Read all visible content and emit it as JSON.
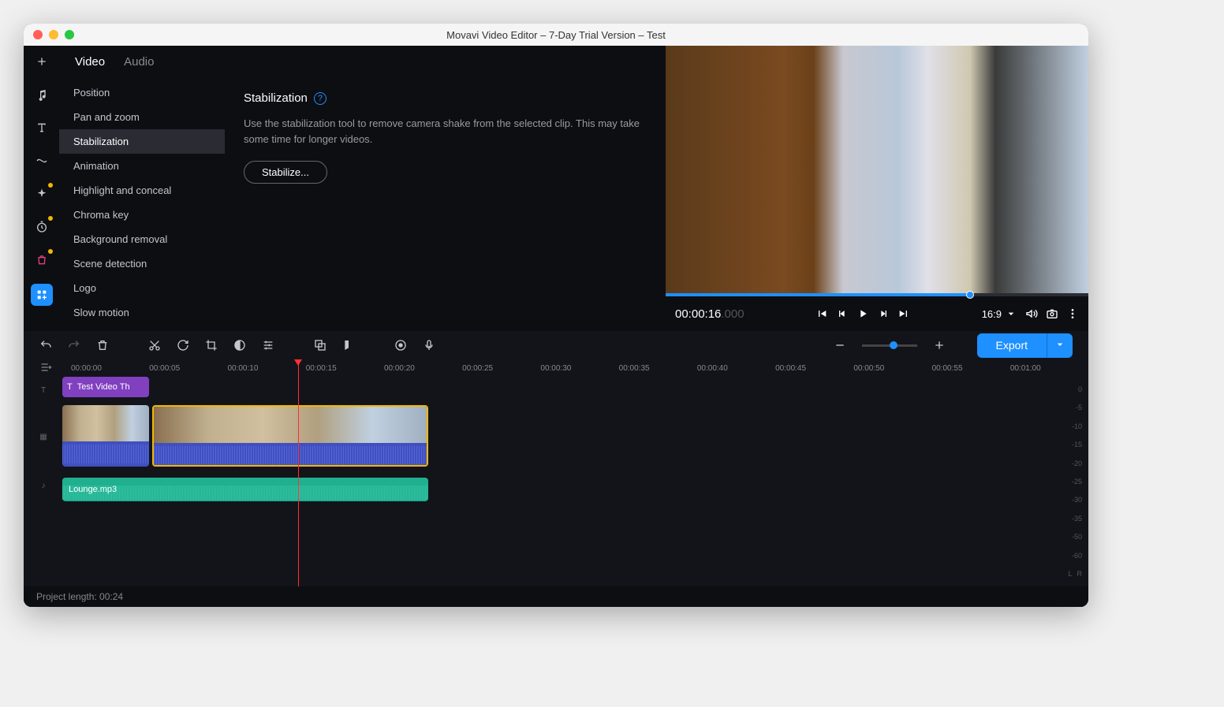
{
  "window": {
    "title": "Movavi Video Editor – 7-Day Trial Version – Test"
  },
  "tabs": {
    "video": "Video",
    "audio": "Audio"
  },
  "sidebar": {
    "items": [
      "Position",
      "Pan and zoom",
      "Stabilization",
      "Animation",
      "Highlight and conceal",
      "Chroma key",
      "Background removal",
      "Scene detection",
      "Logo",
      "Slow motion"
    ]
  },
  "content": {
    "title": "Stabilization",
    "desc": "Use the stabilization tool to remove camera shake from the selected clip. This may take some time for longer videos.",
    "button": "Stabilize..."
  },
  "preview": {
    "timecode": "00:00:16",
    "timecode_ms": ".000",
    "aspect": "16:9"
  },
  "export": {
    "label": "Export"
  },
  "ruler": [
    "00:00:00",
    "00:00:05",
    "00:00:10",
    "00:00:15",
    "00:00:20",
    "00:00:25",
    "00:00:30",
    "00:00:35",
    "00:00:40",
    "00:00:45",
    "00:00:50",
    "00:00:55",
    "00:01:00"
  ],
  "clips": {
    "title": "Test Video Th",
    "audio": "Lounge.mp3"
  },
  "meter": [
    "0",
    "-5",
    "-10",
    "-15",
    "-20",
    "-25",
    "-30",
    "-35",
    "-50",
    "-60"
  ],
  "meter_lr": {
    "l": "L",
    "r": "R"
  },
  "status": {
    "length": "Project length: 00:24"
  }
}
